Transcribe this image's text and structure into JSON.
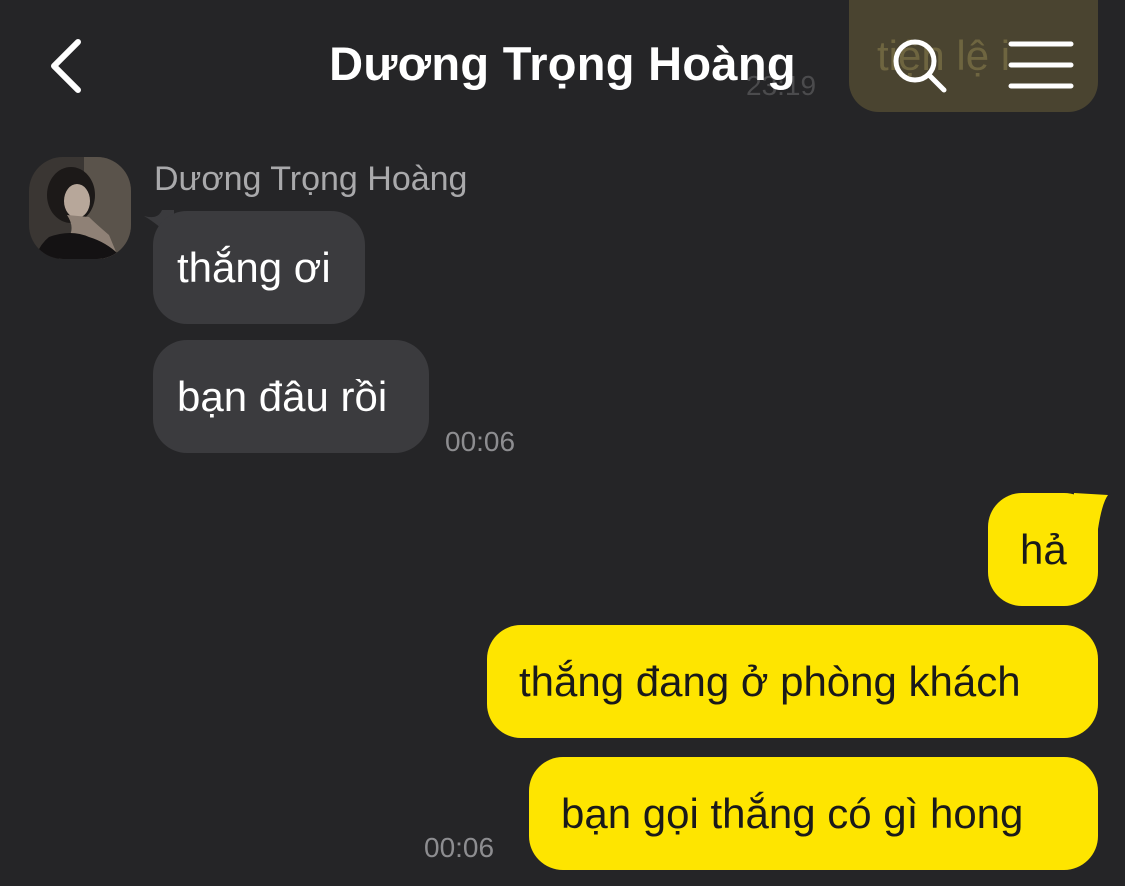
{
  "header": {
    "title": "Dương Trọng Hoàng",
    "back_icon": "chevron-left-icon",
    "search_icon": "search-icon",
    "menu_icon": "hamburger-menu-icon"
  },
  "previous_message": {
    "text": "tiện lệ i",
    "time": "23:19"
  },
  "incoming": {
    "sender_name": "Dương Trọng Hoàng",
    "messages": [
      {
        "text": "thắng ơi"
      },
      {
        "text": "bạn đâu rồi"
      }
    ],
    "time": "00:06"
  },
  "outgoing": {
    "messages": [
      {
        "text": "hả"
      },
      {
        "text": "thắng đang ở phòng khách"
      },
      {
        "text": "bạn gọi thắng có gì hong"
      }
    ],
    "time": "00:06"
  },
  "colors": {
    "background": "#252527",
    "incoming_bubble": "#3b3b3e",
    "outgoing_bubble": "#fee500",
    "timestamp": "#8d8d90"
  }
}
